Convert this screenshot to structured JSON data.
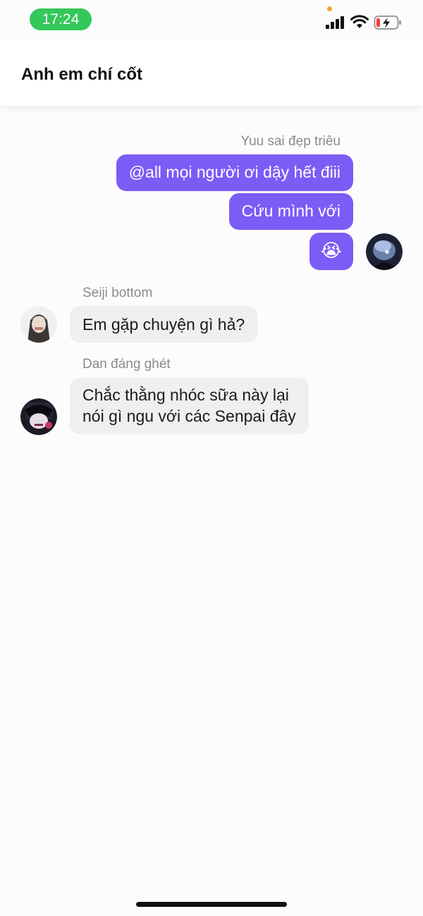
{
  "status_bar": {
    "time": "17:24",
    "icons": [
      "signal-icon",
      "wifi-icon",
      "battery-charging-icon"
    ],
    "battery_level": 0.15,
    "colors": {
      "time_pill": "#34c759",
      "battery_low": "#ff3b30"
    }
  },
  "header": {
    "title": "Anh em chí cốt"
  },
  "messages": [
    {
      "sender": "Yuu sai đẹp triêu",
      "direction": "outgoing",
      "bubbles": [
        "@all mọi người ơi dậy hết điii",
        "Cứu mình với",
        "😭"
      ]
    },
    {
      "sender": "Seiji bottom",
      "direction": "incoming",
      "bubbles": [
        "Em gặp chuyện gì hả?"
      ]
    },
    {
      "sender": "Dan đáng ghét",
      "direction": "incoming",
      "bubbles": [
        "Chắc thằng  nhóc sữa này lại",
        "nói gì ngu với các Senpai đây"
      ]
    }
  ],
  "colors": {
    "outgoing_bubble": "#7b5cf5",
    "incoming_bubble": "#efeff1",
    "sender_name": "#8a8a8e"
  }
}
